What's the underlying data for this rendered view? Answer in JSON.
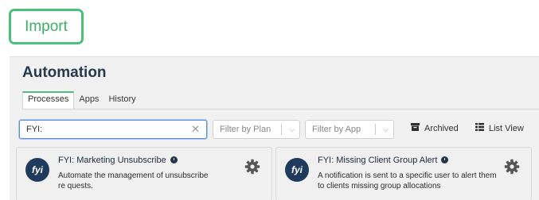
{
  "import_button": {
    "label": "Import"
  },
  "automation": {
    "title": "Automation",
    "tabs": [
      {
        "label": "Processes",
        "active": true
      },
      {
        "label": "Apps",
        "active": false
      },
      {
        "label": "History",
        "active": false
      }
    ],
    "search": {
      "value": "FYI:",
      "clear_icon": "close-icon"
    },
    "filters": {
      "plan_placeholder": "Filter by Plan",
      "app_placeholder": "Filter by App"
    },
    "archived_label": "Archived",
    "list_view_label": "List View",
    "cards": [
      {
        "logo_text": "fyi",
        "title": "FYI: Marketing Unsubscribe",
        "description": "Automate the management of unsubscribe re quests."
      },
      {
        "logo_text": "fyi",
        "title": "FYI: Missing Client Group Alert",
        "description": "A notification is sent to a specific user to alert them to clients missing group allocations"
      }
    ]
  },
  "colors": {
    "accent_green": "#4cc07a",
    "navy": "#1f3a5c",
    "focus_blue": "#5b8fd6"
  }
}
